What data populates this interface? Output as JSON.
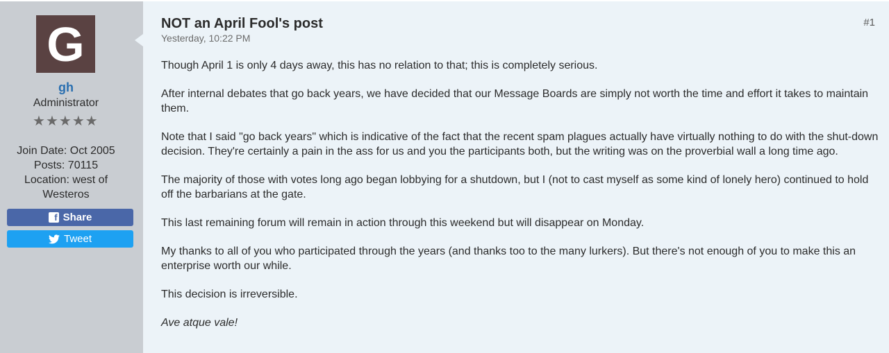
{
  "user": {
    "avatar_letter": "G",
    "name": "gh",
    "title": "Administrator",
    "stars": 5,
    "join_date": "Join Date: Oct 2005",
    "posts": "Posts: 70115",
    "location_line1": "Location: west of",
    "location_line2": "Westeros",
    "share_label": "Share",
    "tweet_label": "Tweet"
  },
  "post": {
    "title": "NOT an April Fool's post",
    "date": "Yesterday, 10:22 PM",
    "number": "#1",
    "paragraphs": [
      "Though April 1 is only 4 days away, this has no relation to that; this is completely serious.",
      "After internal debates that go back years, we have decided that our Message Boards are simply not worth the time and effort it takes to maintain them.",
      "Note that I said \"go back years\" which is indicative of the fact that the recent spam plagues actually have virtually nothing to do with the shut-down decision. They're certainly a pain in the ass for us and you the participants both, but the writing was on the proverbial wall a long time ago.",
      "The majority of those with votes long ago began lobbying for a shutdown, but I (not to cast myself as some kind of lonely hero) continued to hold off the barbarians at the gate.",
      "This last remaining forum will remain in action through this weekend but will disappear on Monday.",
      "My thanks to all of you who participated through the years (and thanks too to the many lurkers). But there's not enough of you to make this an enterprise worth our while.",
      "This decision is irreversible."
    ],
    "signoff": "Ave atque vale!"
  },
  "colors": {
    "sidebar_bg": "#c9cdd2",
    "content_bg": "#ecf3f8",
    "username": "#2a6fb0",
    "share_button": "#4a67a8",
    "tweet_button": "#1da1f2",
    "avatar_bg": "#5a4242"
  },
  "icons": {
    "stars": "star-icon",
    "share": "facebook-icon",
    "tweet": "twitter-bird-icon"
  }
}
